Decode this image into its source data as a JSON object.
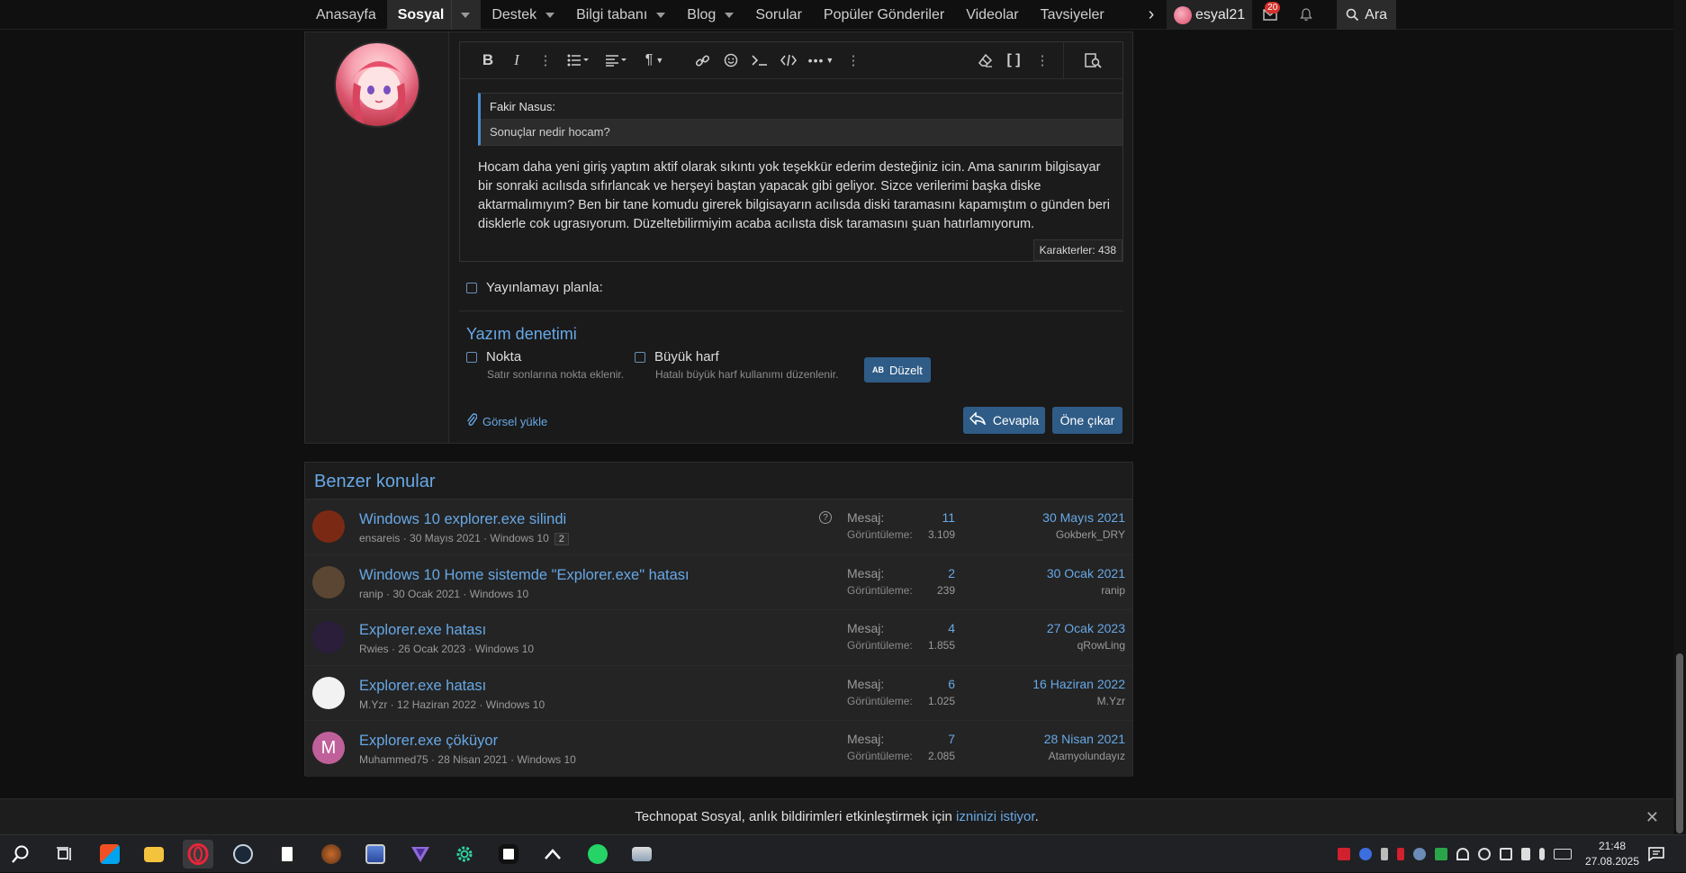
{
  "nav": {
    "items": [
      {
        "label": "Anasayfa",
        "caret": false,
        "active": false
      },
      {
        "label": "Sosyal",
        "caret": true,
        "active": true
      },
      {
        "label": "Destek",
        "caret": true,
        "active": false
      },
      {
        "label": "Bilgi tabanı",
        "caret": true,
        "active": false
      },
      {
        "label": "Blog",
        "caret": true,
        "active": false
      },
      {
        "label": "Sorular",
        "caret": false,
        "active": false
      },
      {
        "label": "Popüler Gönderiler",
        "caret": false,
        "active": false
      },
      {
        "label": "Videolar",
        "caret": false,
        "active": false
      },
      {
        "label": "Tavsiyeler",
        "caret": false,
        "active": false
      }
    ],
    "username": "esyal21",
    "inbox_badge": "20",
    "search_label": "Ara"
  },
  "editor": {
    "quote_author": "Fakir Nasus:",
    "quote_text": "Sonuçlar nedir hocam?",
    "body": "Hocam daha yeni giriş yaptım aktif olarak sıkıntı yok teşekkür ederim desteğiniz icin. Ama sanırım bilgisayar bir sonraki acılısda sıfırlancak ve herşeyi baştan yapacak gibi geliyor. Sizce verilerimi başka diske aktarmalımıyım? Ben bir tane komudu girerek bilgisayarın acılısda diski taramasını kapamıştım o günden beri disklerle cok ugrasıyorum. Düzeltebilirmiyim acaba acılısta disk taramasını şuan hatırlamıyorum.",
    "char_count": "Karakterler: 438"
  },
  "form": {
    "schedule_label": "Yayınlamayı planla:",
    "spellcheck_title": "Yazım denetimi",
    "option_dot_label": "Nokta",
    "option_dot_desc": "Satır sonlarına nokta eklenir.",
    "option_caps_label": "Büyük harf",
    "option_caps_desc": "Hatalı büyük harf kullanımı düzenlenir.",
    "fix_button": "Düzelt",
    "fix_icon_text": "AB",
    "upload_label": "Görsel yükle",
    "reply_button": "Cevapla",
    "pin_button": "Öne çıkar"
  },
  "similar": {
    "title": "Benzer konular",
    "label_messages": "Mesaj:",
    "label_views": "Görüntüleme:",
    "rows": [
      {
        "title": "Windows 10 explorer.exe silindi",
        "author": "ensareis",
        "date": "30 Mayıs 2021",
        "forum": "Windows 10",
        "pages": "2",
        "question": true,
        "messages": "11",
        "views": "3.109",
        "last_date": "30 Mayıs 2021",
        "last_user": "Gokberk_DRY",
        "avatar_color": "#7a2a14"
      },
      {
        "title": "Windows 10 Home sistemde \"Explorer.exe\" hatası",
        "author": "ranip",
        "date": "30 Ocak 2021",
        "forum": "Windows 10",
        "pages": "",
        "question": false,
        "messages": "2",
        "views": "239",
        "last_date": "30 Ocak 2021",
        "last_user": "ranip",
        "avatar_color": "#5a4632"
      },
      {
        "title": "Explorer.exe hatası",
        "author": "Rwies",
        "date": "26 Ocak 2023",
        "forum": "Windows 10",
        "pages": "",
        "question": false,
        "messages": "4",
        "views": "1.855",
        "last_date": "27 Ocak 2023",
        "last_user": "qRowLing",
        "avatar_color": "#2a1e3a"
      },
      {
        "title": "Explorer.exe hatası",
        "author": "M.Yzr",
        "date": "12 Haziran 2022",
        "forum": "Windows 10",
        "pages": "",
        "question": false,
        "messages": "6",
        "views": "1.025",
        "last_date": "16 Haziran 2022",
        "last_user": "M.Yzr",
        "avatar_color": "#f2f2f2"
      },
      {
        "title": "Explorer.exe çöküyor",
        "author": "Muhammed75",
        "date": "28 Nisan 2021",
        "forum": "Windows 10",
        "pages": "",
        "question": false,
        "messages": "7",
        "views": "2.085",
        "last_date": "28 Nisan 2021",
        "last_user": "Atamyolundayız",
        "avatar_color": "#c0609a",
        "avatar_letter": "M"
      }
    ]
  },
  "notification": {
    "text_before": "Technopat Sosyal, anlık bildirimleri etkinleştirmek için ",
    "link_text": "izninizi istiyor",
    "text_after": "."
  },
  "taskbar": {
    "time": "21:48",
    "date": "27.08.2025"
  },
  "colors": {
    "accent": "#67a8e6",
    "button": "#2f5c87",
    "badge": "#d6322c"
  }
}
